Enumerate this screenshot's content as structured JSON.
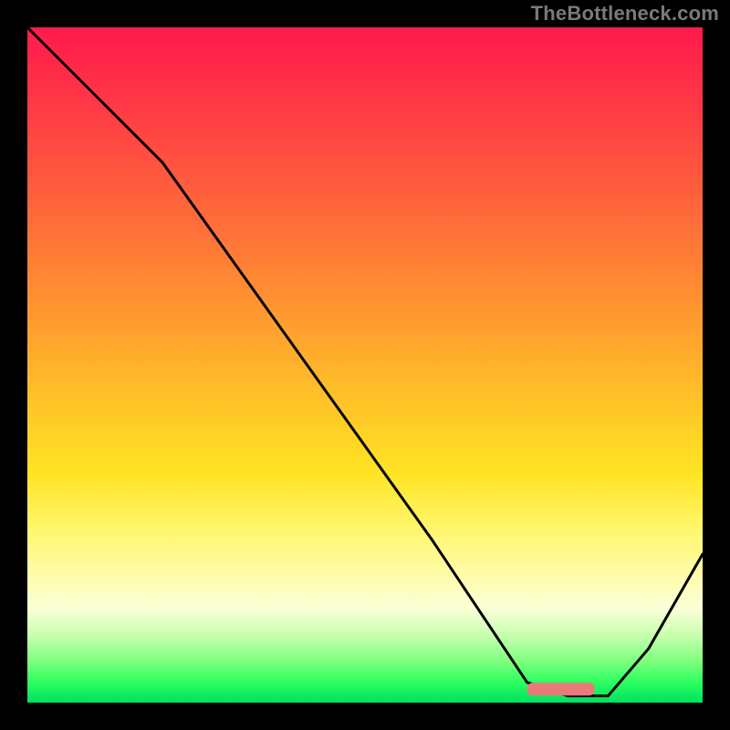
{
  "watermark": "TheBottleneck.com",
  "chart_data": {
    "type": "line",
    "title": "",
    "xlabel": "",
    "ylabel": "",
    "xlim": [
      0,
      100
    ],
    "ylim": [
      0,
      100
    ],
    "grid": false,
    "background_gradient": [
      "#ff1a4b",
      "#ff6a3a",
      "#ffc228",
      "#fff66a",
      "#c8ffb0",
      "#00e060"
    ],
    "series": [
      {
        "name": "bottleneck-curve",
        "x": [
          0,
          10,
          20,
          30,
          40,
          50,
          60,
          68,
          74,
          80,
          86,
          92,
          100
        ],
        "values": [
          100,
          90,
          80,
          66,
          52,
          38,
          24,
          12,
          3,
          1,
          1,
          8,
          22
        ]
      }
    ],
    "marker": {
      "name": "optimal-range",
      "x_start": 74,
      "x_end": 84,
      "y": 2,
      "color": "#e97a7a"
    }
  }
}
